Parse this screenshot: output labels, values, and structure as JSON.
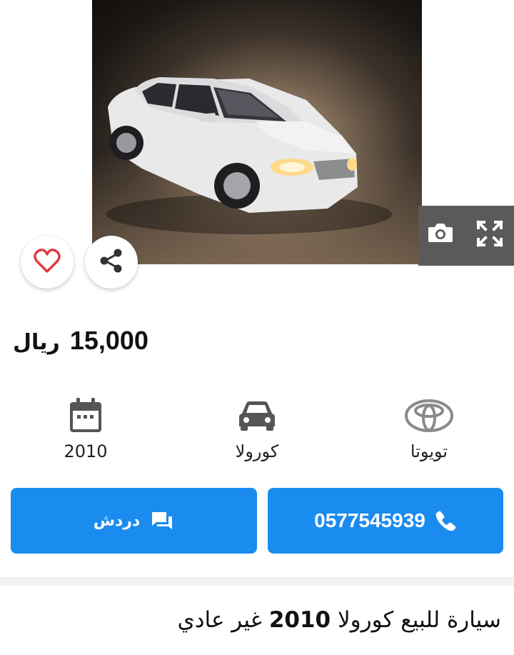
{
  "listing": {
    "price_amount": "15,000",
    "price_currency": "ريال",
    "title_part1": "سيارة للبيع كورولا",
    "title_year": "2010",
    "title_part2": "غير عادي"
  },
  "specs": {
    "year": "2010",
    "model": "كورولا",
    "make": "تويوتا"
  },
  "actions": {
    "phone": "0577545939",
    "chat_label": "دردش"
  },
  "icons": {
    "favorite": "heart-icon",
    "share": "share-icon",
    "camera": "camera-icon",
    "expand": "fullscreen-icon",
    "calendar": "calendar-icon",
    "car": "car-icon",
    "brand": "toyota-logo",
    "phone": "phone-icon",
    "chat": "chat-icon"
  },
  "colors": {
    "accent": "#1a8cf0",
    "heart": "#e0393e",
    "icon_gray": "#555555"
  }
}
